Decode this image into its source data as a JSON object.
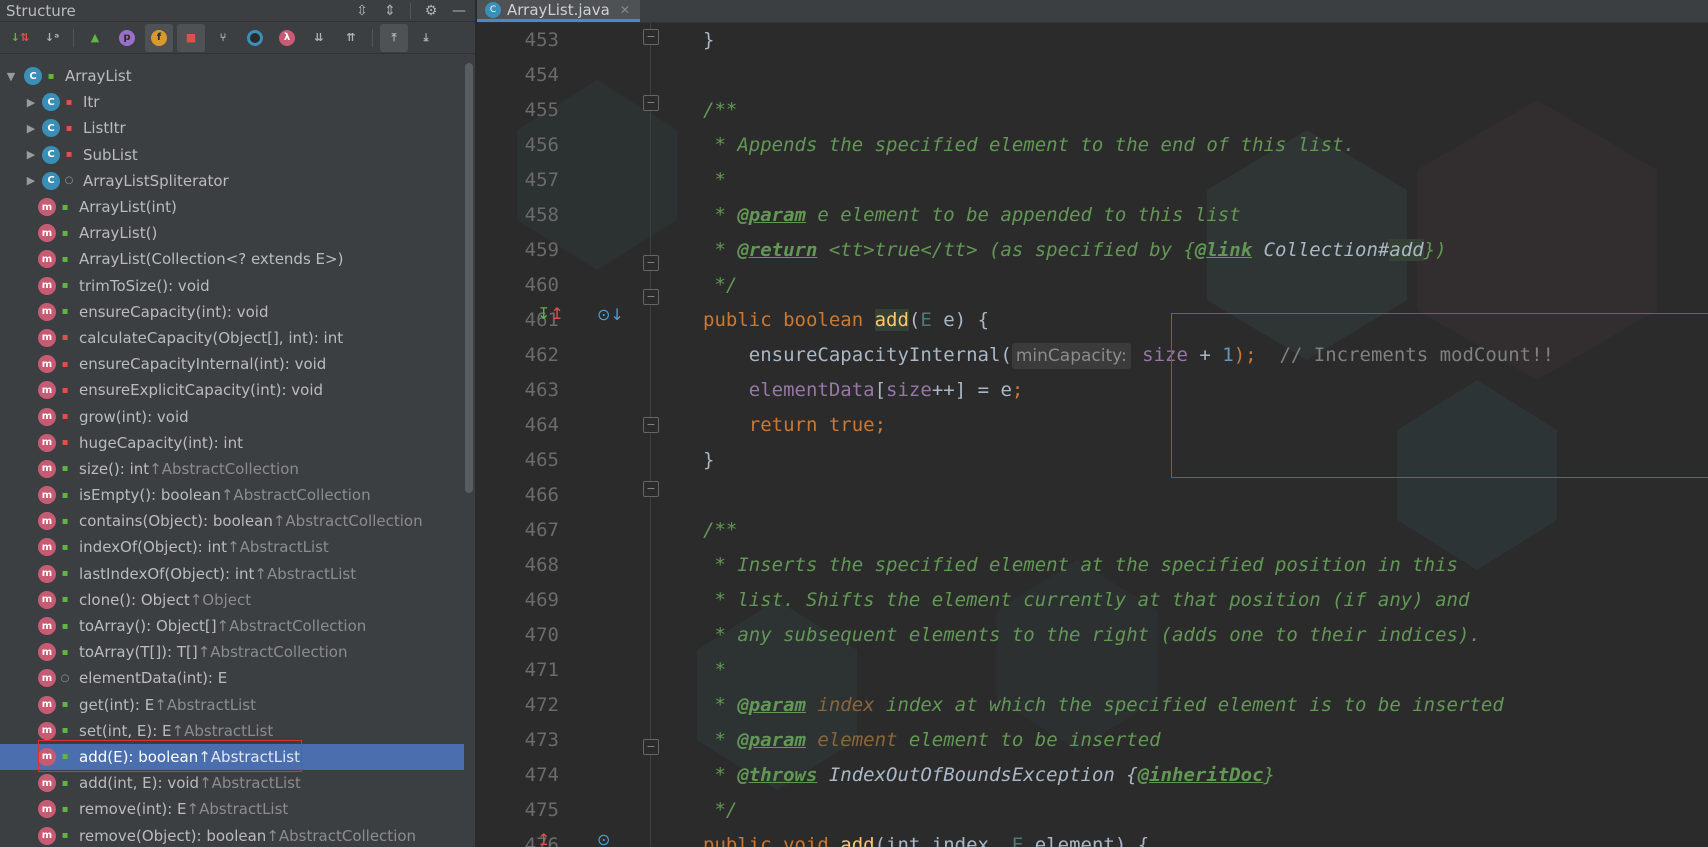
{
  "structure": {
    "title": "Structure",
    "header_icons": [
      "expand-all-icon",
      "collapse-all-icon",
      "gear-icon",
      "minimize-icon"
    ],
    "toolbar": [
      {
        "name": "sort-by-visibility-icon",
        "glyph": "↓⇅"
      },
      {
        "name": "sort-alphabetically-icon",
        "glyph": "↓a"
      },
      {
        "name": "show-inherited-icon",
        "glyph": "▲"
      },
      {
        "name": "show-properties-icon",
        "glyph": "p"
      },
      {
        "name": "show-fields-icon",
        "glyph": "f"
      },
      {
        "name": "show-non-public-icon",
        "glyph": "🔒"
      },
      {
        "name": "show-inherited-members-icon",
        "glyph": "⑂"
      },
      {
        "name": "show-anonymous-icon",
        "glyph": "○"
      },
      {
        "name": "show-lambdas-icon",
        "glyph": "λ"
      },
      {
        "name": "expand-all-icon",
        "glyph": "⇊"
      },
      {
        "name": "collapse-all-icon",
        "glyph": "⇈"
      },
      {
        "name": "autoscroll-to-source-icon",
        "glyph": "⤒"
      },
      {
        "name": "autoscroll-from-source-icon",
        "glyph": "⤓"
      }
    ],
    "root": {
      "label": "ArrayList"
    },
    "items": [
      {
        "label": "Itr",
        "suffix": "",
        "kind": "class",
        "vis": "private",
        "arrow": true
      },
      {
        "label": "ListItr",
        "suffix": "",
        "kind": "class",
        "vis": "private",
        "arrow": true
      },
      {
        "label": "SubList",
        "suffix": "",
        "kind": "class",
        "vis": "private",
        "arrow": true
      },
      {
        "label": "ArrayListSpliterator",
        "suffix": "",
        "kind": "class",
        "vis": "package",
        "arrow": true
      },
      {
        "label": "ArrayList(int)",
        "suffix": "",
        "kind": "method",
        "vis": "public"
      },
      {
        "label": "ArrayList()",
        "suffix": "",
        "kind": "method",
        "vis": "public"
      },
      {
        "label": "ArrayList(Collection<? extends E>)",
        "suffix": "",
        "kind": "method",
        "vis": "public"
      },
      {
        "label": "trimToSize(): void",
        "suffix": "",
        "kind": "method",
        "vis": "public"
      },
      {
        "label": "ensureCapacity(int): void",
        "suffix": "",
        "kind": "method",
        "vis": "public"
      },
      {
        "label": "calculateCapacity(Object[], int): int",
        "suffix": "",
        "kind": "method",
        "vis": "private"
      },
      {
        "label": "ensureCapacityInternal(int): void",
        "suffix": "",
        "kind": "method",
        "vis": "private"
      },
      {
        "label": "ensureExplicitCapacity(int): void",
        "suffix": "",
        "kind": "method",
        "vis": "private"
      },
      {
        "label": "grow(int): void",
        "suffix": "",
        "kind": "method",
        "vis": "private"
      },
      {
        "label": "hugeCapacity(int): int",
        "suffix": "",
        "kind": "method",
        "vis": "private"
      },
      {
        "label": "size(): int ",
        "suffix": "↑AbstractCollection",
        "kind": "method",
        "vis": "public"
      },
      {
        "label": "isEmpty(): boolean ",
        "suffix": "↑AbstractCollection",
        "kind": "method",
        "vis": "public"
      },
      {
        "label": "contains(Object): boolean ",
        "suffix": "↑AbstractCollection",
        "kind": "method",
        "vis": "public"
      },
      {
        "label": "indexOf(Object): int ",
        "suffix": "↑AbstractList",
        "kind": "method",
        "vis": "public"
      },
      {
        "label": "lastIndexOf(Object): int ",
        "suffix": "↑AbstractList",
        "kind": "method",
        "vis": "public"
      },
      {
        "label": "clone(): Object ",
        "suffix": "↑Object",
        "kind": "method",
        "vis": "public"
      },
      {
        "label": "toArray(): Object[] ",
        "suffix": "↑AbstractCollection",
        "kind": "method",
        "vis": "public"
      },
      {
        "label": "toArray(T[]): T[] ",
        "suffix": "↑AbstractCollection",
        "kind": "method",
        "vis": "public"
      },
      {
        "label": "elementData(int): E",
        "suffix": "",
        "kind": "method",
        "vis": "package"
      },
      {
        "label": "get(int): E ",
        "suffix": "↑AbstractList",
        "kind": "method",
        "vis": "public"
      },
      {
        "label": "set(int, E): E ",
        "suffix": "↑AbstractList",
        "kind": "method",
        "vis": "public"
      },
      {
        "label": "add(E): boolean ",
        "suffix": "↑AbstractList",
        "kind": "method",
        "vis": "public",
        "selected": true
      },
      {
        "label": "add(int, E): void ",
        "suffix": "↑AbstractList",
        "kind": "method",
        "vis": "public"
      },
      {
        "label": "remove(int): E ",
        "suffix": "↑AbstractList",
        "kind": "method",
        "vis": "public"
      },
      {
        "label": "remove(Object): boolean ",
        "suffix": "↑AbstractCollection",
        "kind": "method",
        "vis": "public"
      }
    ]
  },
  "editor": {
    "tab": {
      "label": "ArrayList.java"
    },
    "line_numbers": [
      "453",
      "454",
      "455",
      "456",
      "457",
      "458",
      "459",
      "460",
      "461",
      "462",
      "463",
      "464",
      "465",
      "466",
      "467",
      "468",
      "469",
      "470",
      "471",
      "472",
      "473",
      "474",
      "475",
      "476"
    ],
    "code": {
      "l453": "}",
      "l455": "/**",
      "l456": " * Appends the specified element to the end of this list.",
      "l457": " *",
      "l458_pre": " * ",
      "l458_tag": "@param",
      "l458_post": " e element to be appended to this list",
      "l459_pre": " * ",
      "l459_tag": "@return",
      "l459_a": " <tt>true</tt> (as specified by {",
      "l459_link": "@link",
      "l459_b": " Collection#",
      "l459_add": "add",
      "l459_c": "})",
      "l460": " */",
      "l461_kw": "public boolean ",
      "l461_fn": "add",
      "l461_a": "(",
      "l461_tp": "E",
      "l461_b": " e) {",
      "l462_a": "    ensureCapacityInternal(",
      "l462_hint": "minCapacity:",
      "l462_fld": " size",
      "l462_b": " + ",
      "l462_num": "1",
      "l462_c": ");",
      "l462_cm": "  // Increments modCount!!",
      "l463_fld": "    elementData",
      "l463_a": "[",
      "l463_size": "size",
      "l463_b": "++] = e",
      "l463_c": ";",
      "l464_kw": "    return true",
      "l464_c": ";",
      "l465": "}",
      "l467": "/**",
      "l468": " * Inserts the specified element at the specified position in this",
      "l469": " * list. Shifts the element currently at that position (if any) and",
      "l470": " * any subsequent elements to the right (adds one to their indices).",
      "l471": " *",
      "l472_pre": " * ",
      "l472_tag": "@param",
      "l472_p": " index",
      "l472_post": " index at which the specified element is to be inserted",
      "l473_pre": " * ",
      "l473_tag": "@param",
      "l473_p": " element",
      "l473_post": " element to be inserted",
      "l474_pre": " * ",
      "l474_tag": "@throws",
      "l474_a": " IndexOutOfBoundsException {",
      "l474_link": "@inheritDoc",
      "l474_b": "}",
      "l475": " */",
      "l476_kw": "public void ",
      "l476_fn": "add",
      "l476_a": "(int index, ",
      "l476_tp": "E",
      "l476_b": " element) {"
    }
  }
}
